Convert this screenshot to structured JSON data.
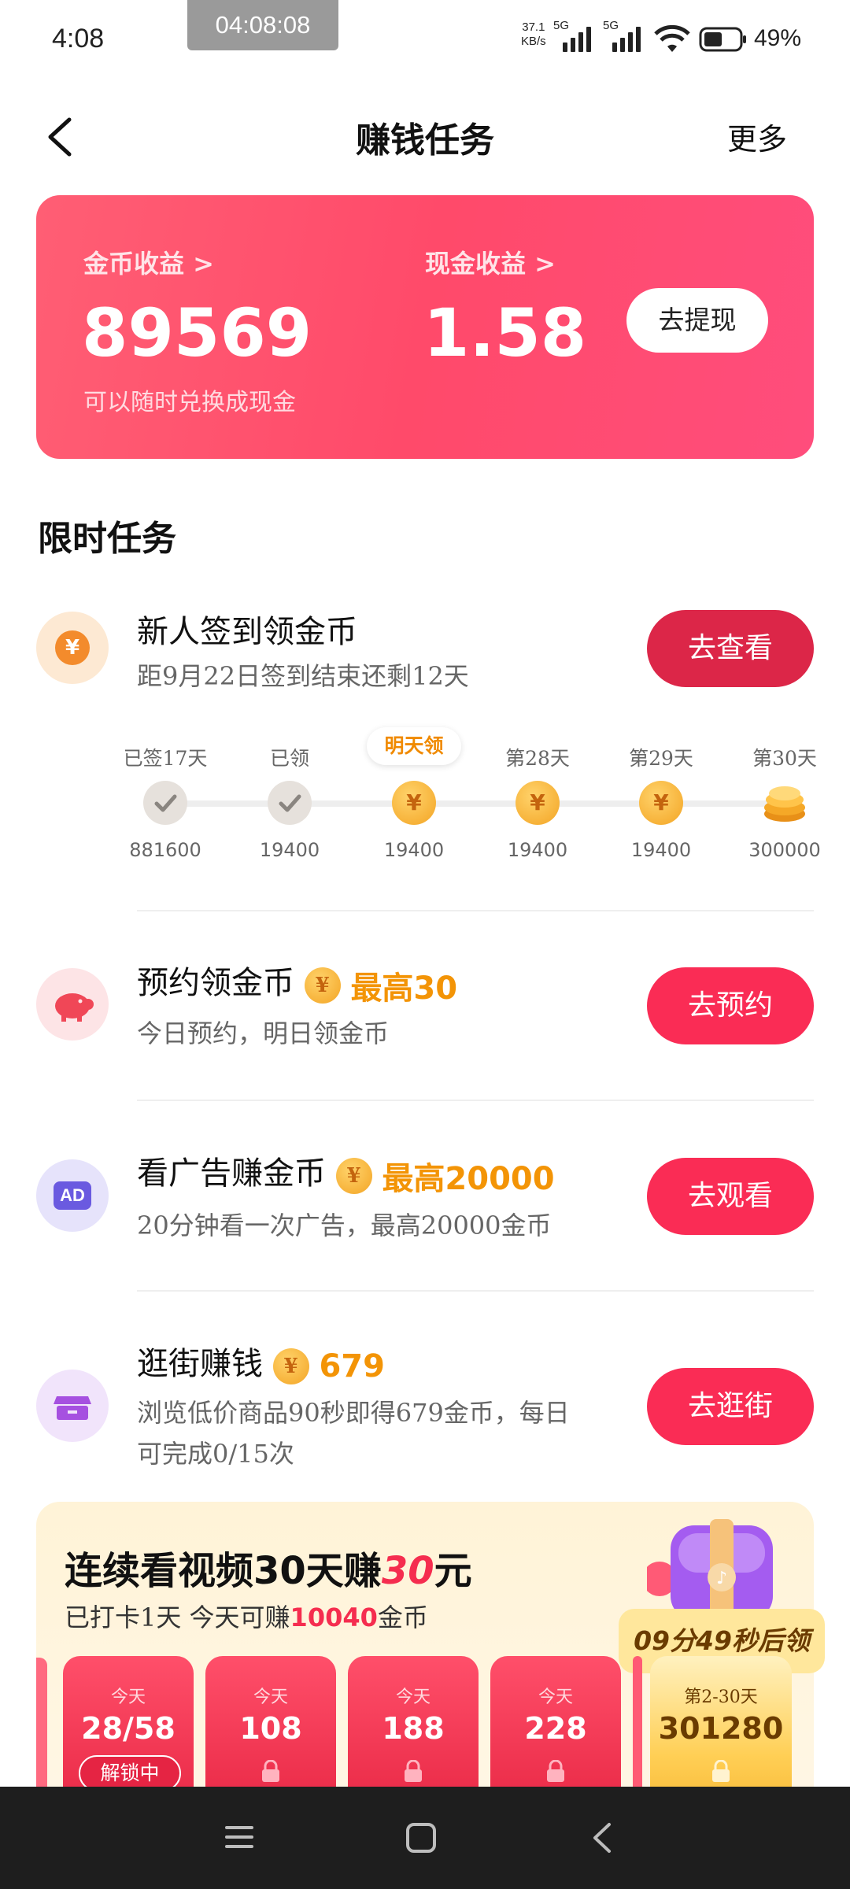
{
  "status_bar": {
    "time": "4:08",
    "recording_time": "04:08:08",
    "net_speed_top": "37.1",
    "net_speed_bottom": "KB/s",
    "signal1": "5G",
    "signal2": "5G",
    "battery": "49%"
  },
  "header": {
    "title": "赚钱任务",
    "more_label": "更多"
  },
  "earnings": {
    "coin_label": "金币收益 >",
    "coin_value": "89569",
    "cash_label": "现金收益 >",
    "cash_value": "1.58",
    "note": "可以随时兑换成现金",
    "withdraw_label": "去提现"
  },
  "section_title": "限时任务",
  "tasks": [
    {
      "title": "新人签到领金币",
      "desc": "距9月22日签到结束还剩12天",
      "button": "去查看",
      "icon": "coin-icon"
    },
    {
      "title": "预约领金币",
      "reward": "最高30",
      "desc": "今日预约，明日领金币",
      "button": "去预约",
      "icon": "piggy-bank-icon"
    },
    {
      "title": "看广告赚金币",
      "reward": "最高20000",
      "desc": "20分钟看一次广告，最高20000金币",
      "button": "去观看",
      "icon": "ad-icon",
      "icon_text": "AD"
    },
    {
      "title": "逛街赚钱",
      "reward": "679",
      "desc_line1": "浏览低价商品90秒即得679金币，每日",
      "desc_line2": "可完成0/15次",
      "button": "去逛街",
      "icon": "shop-icon"
    }
  ],
  "coin_symbol": "¥",
  "checkin": {
    "tomorrow_badge": "明天领",
    "days": [
      {
        "label": "已签17天",
        "amount": "881600",
        "state": "done"
      },
      {
        "label": "已领",
        "amount": "19400",
        "state": "done"
      },
      {
        "label": "",
        "amount": "19400",
        "state": "next"
      },
      {
        "label": "第28天",
        "amount": "19400",
        "state": "coin"
      },
      {
        "label": "第29天",
        "amount": "19400",
        "state": "coin"
      },
      {
        "label": "第30天",
        "amount": "300000",
        "state": "stack"
      }
    ]
  },
  "promo": {
    "title_a": "连续看视频30天赚",
    "title_num": "30",
    "title_b": "元",
    "sub_a": "已打卡1天  今天可赚",
    "sub_num": "10040",
    "sub_b": "金币",
    "timer": "09分49秒后领",
    "tiles": [
      {
        "top": "今天",
        "value": "28/58"
      },
      {
        "top": "今天",
        "value": "108"
      },
      {
        "top": "今天",
        "value": "188"
      },
      {
        "top": "今天",
        "value": "228"
      },
      {
        "top": "第2-30天",
        "value": "301280"
      }
    ],
    "unlock_label": "解锁中"
  },
  "colors": {
    "accent": "#fa2c55",
    "card_bg": "#ff5e74",
    "coin_gold": "#f39406"
  }
}
